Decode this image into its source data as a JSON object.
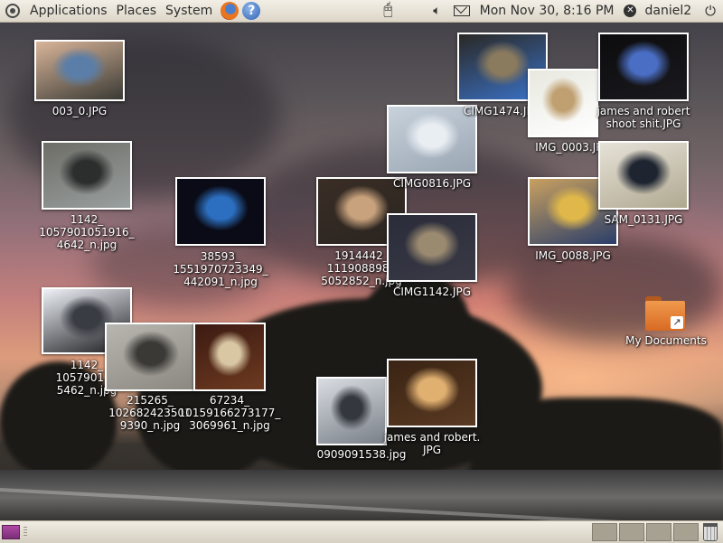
{
  "top_panel": {
    "menus": [
      "Applications",
      "Places",
      "System"
    ],
    "clock": "Mon Nov 30,  8:16 PM",
    "user": "daniel2"
  },
  "desktop_icons": [
    {
      "label": "003_0.JPG",
      "colors": [
        "#d9b59a",
        "#5a7ea8",
        "#3a3a34"
      ]
    },
    {
      "label": "1142_\n1057901051916_\n4642_n.jpg",
      "colors": [
        "#6d6d66",
        "#2c2e2e",
        "#9aa0a0"
      ]
    },
    {
      "label": "38593_\n1551970723349_\n442091_n.jpg",
      "colors": [
        "#0a0b16",
        "#2c6fc0",
        "#0a0b16"
      ]
    },
    {
      "label": "1142_\n105790125\n5462_n.jpg",
      "colors": [
        "#eef2f7",
        "#3a3c44",
        "#1b1c20"
      ]
    },
    {
      "label": "215265_\n102682423501\n9390_n.jpg",
      "colors": [
        "#b8b6b0",
        "#3a3936",
        "#8b8880"
      ]
    },
    {
      "label": "67234_\n10159166273177_\n3069961_n.jpg",
      "colors": [
        "#3c1a12",
        "#d9c7a3",
        "#6d3a20"
      ]
    },
    {
      "label": "1914442_\n1119088981\n5052852_n.jpg",
      "colors": [
        "#3a2e26",
        "#c8a27c",
        "#2a2420"
      ]
    },
    {
      "label": "CIMG0816.JPG",
      "colors": [
        "#c8d2dc",
        "#e9eef3",
        "#9aa6b3"
      ]
    },
    {
      "label": "CIMG1142.JPG",
      "colors": [
        "#2a2c3a",
        "#9a8a70",
        "#3a3a46"
      ]
    },
    {
      "label": "0909091538.jpg",
      "colors": [
        "#d9dde2",
        "#34383e",
        "#7a8088"
      ]
    },
    {
      "label": "james and robert.\nJPG",
      "colors": [
        "#3a2414",
        "#e0b070",
        "#5a3a22"
      ]
    },
    {
      "label": "CIMG1474.JPG",
      "colors": [
        "#2a2824",
        "#8a7a5e",
        "#3a72c8"
      ]
    },
    {
      "label": "IMG_0003.JPG",
      "colors": [
        "#e8e8e0",
        "#c0a070",
        "#ffffff"
      ]
    },
    {
      "label": "james and robert\nshoot shit.JPG",
      "colors": [
        "#0c0c0e",
        "#4a6ec4",
        "#1a1a1e"
      ]
    },
    {
      "label": "IMG_0088.JPG",
      "colors": [
        "#c8a060",
        "#e0b84a",
        "#2a3e6a"
      ]
    },
    {
      "label": "SAM_0131.JPG",
      "colors": [
        "#e6e2d8",
        "#1e2430",
        "#b0a890"
      ]
    },
    {
      "label": "My Documents",
      "colors": [
        "#f09a4e"
      ]
    }
  ]
}
